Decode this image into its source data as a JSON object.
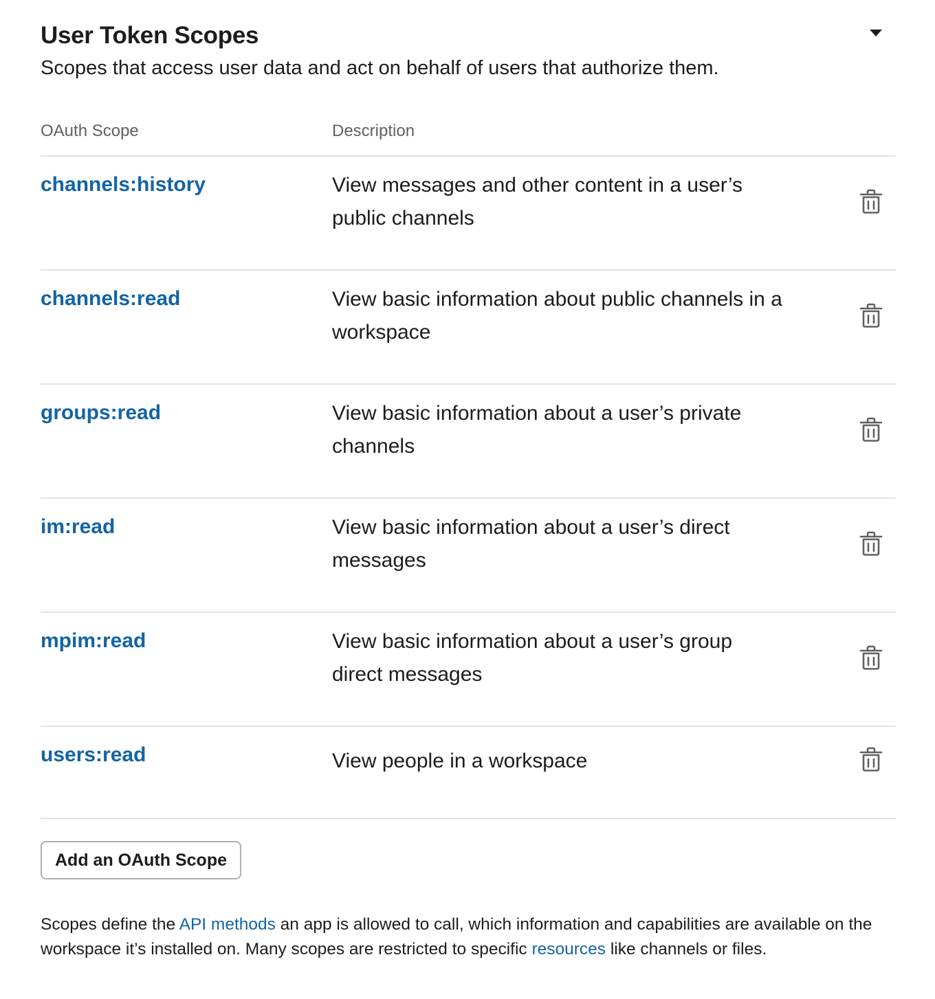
{
  "section": {
    "title": "User Token Scopes",
    "subtitle": "Scopes that access user data and act on behalf of users that authorize them."
  },
  "columns": {
    "scope": "OAuth Scope",
    "description": "Description"
  },
  "scopes": [
    {
      "name": "channels:history",
      "description": "View messages and other content in a user’s public channels"
    },
    {
      "name": "channels:read",
      "description": "View basic information about public channels in a workspace"
    },
    {
      "name": "groups:read",
      "description": "View basic information about a user’s private channels"
    },
    {
      "name": "im:read",
      "description": "View basic information about a user’s direct messages"
    },
    {
      "name": "mpim:read",
      "description": "View basic information about a user’s group direct messages"
    },
    {
      "name": "users:read",
      "description": "View people in a workspace"
    }
  ],
  "add_button": "Add an OAuth Scope",
  "footer": {
    "text_1": "Scopes define the ",
    "link_1": "API methods",
    "text_2": " an app is allowed to call, which information and capabilities are available on the workspace it’s installed on. Many scopes are restricted to specific ",
    "link_2": "resources",
    "text_3": " like channels or files."
  },
  "colors": {
    "link": "#1264a3",
    "text": "#1d1c1d",
    "muted": "#616061",
    "divider": "#e2e2e2"
  },
  "icons": {
    "collapse": "caret-down-icon",
    "delete": "trash-icon"
  }
}
